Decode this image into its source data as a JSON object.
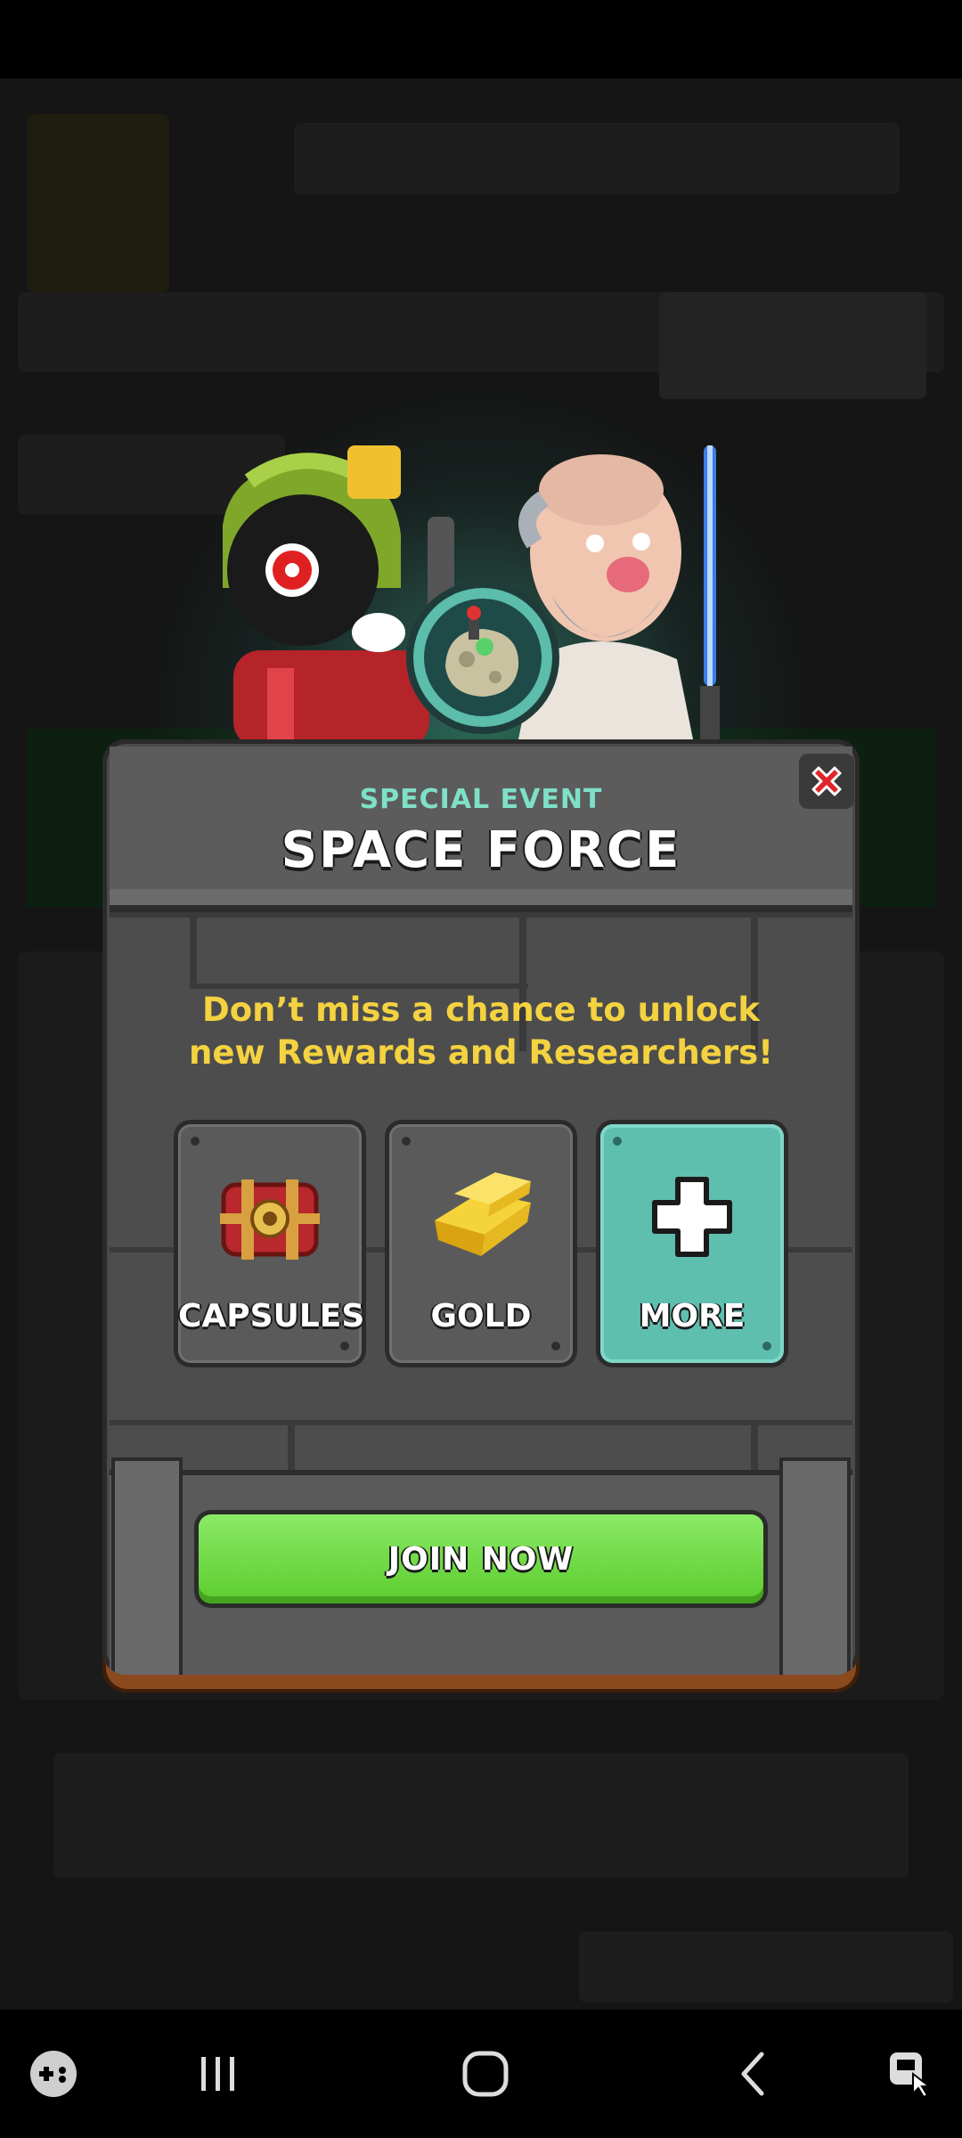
{
  "popup": {
    "kicker": "SPECIAL EVENT",
    "title": "SPACE FORCE",
    "message": "Don’t miss a chance to unlock new Rewards and Researchers!",
    "rewards": [
      {
        "label": "CAPSULES",
        "icon": "capsule-chest-icon"
      },
      {
        "label": "GOLD",
        "icon": "gold-bar-icon"
      },
      {
        "label": "MORE",
        "icon": "plus-icon"
      }
    ],
    "join_label": "JOIN NOW",
    "close_icon": "close-icon"
  },
  "colors": {
    "kicker": "#7fe0c8",
    "message": "#f4d240",
    "join_button": "#6ad83f",
    "more_tile": "#5fbfaf",
    "close": "#e0262a"
  },
  "nav": {
    "icons": [
      "game-launcher-icon",
      "recent-apps-icon",
      "home-icon",
      "back-icon",
      "accessibility-icon"
    ]
  }
}
